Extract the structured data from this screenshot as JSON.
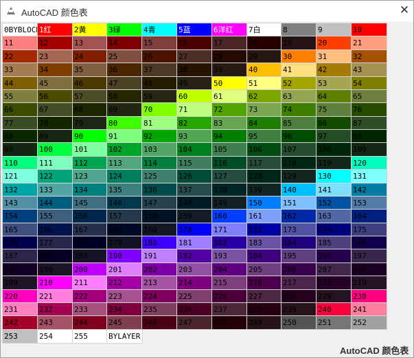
{
  "window": {
    "title": "AutoCAD 颜色表",
    "close_glyph": "✕",
    "footer_label": "AutoCAD 颜色表"
  },
  "special_labels": {
    "0": "0BYBLOCK",
    "1": "1红",
    "2": "2黄",
    "3": "3绿",
    "4": "4青",
    "5": "5蓝",
    "6": "6洋红",
    "7": "7白",
    "256": "BYLAYER"
  },
  "palette": [
    "#ffffff",
    "#ff0000",
    "#ffff00",
    "#00ff00",
    "#00ffff",
    "#0000ff",
    "#ff00ff",
    "#ffffff",
    "#808080",
    "#c0c0c0",
    "#ff0000",
    "#ff7f7f",
    "#a50000",
    "#a55252",
    "#7f0000",
    "#7f3f3f",
    "#4c0000",
    "#4c2626",
    "#260000",
    "#261313",
    "#ff3f00",
    "#ff9f7f",
    "#a52900",
    "#a56752",
    "#7f1f00",
    "#7f4f3f",
    "#4c1300",
    "#4c2f26",
    "#260900",
    "#261713",
    "#ff7f00",
    "#ffbf7f",
    "#a55200",
    "#a57c52",
    "#7f3f00",
    "#7f5f3f",
    "#4c2600",
    "#4c3926",
    "#261300",
    "#261c13",
    "#ffbf00",
    "#ffdf7f",
    "#a57c00",
    "#a59152",
    "#7f5f00",
    "#7f6f3f",
    "#4c3900",
    "#4c4226",
    "#261c00",
    "#262113",
    "#ffff00",
    "#ffff7f",
    "#a5a500",
    "#a5a552",
    "#7f7f00",
    "#7f7f3f",
    "#4c4c00",
    "#4c4c26",
    "#262600",
    "#262613",
    "#bfff00",
    "#dfff7f",
    "#7ca500",
    "#91a552",
    "#5f7f00",
    "#6f7f3f",
    "#394c00",
    "#424c26",
    "#1c2600",
    "#212613",
    "#7fff00",
    "#bfff7f",
    "#52a500",
    "#7ca552",
    "#3f7f00",
    "#5f7f3f",
    "#264c00",
    "#394c26",
    "#132600",
    "#1c2613",
    "#3fff00",
    "#9fff7f",
    "#29a500",
    "#67a552",
    "#1f7f00",
    "#4f7f3f",
    "#134c00",
    "#2f4c26",
    "#092600",
    "#172613",
    "#00ff00",
    "#7fff7f",
    "#00a500",
    "#52a552",
    "#007f00",
    "#3f7f3f",
    "#004c00",
    "#264c26",
    "#002600",
    "#132613",
    "#00ff3f",
    "#7fff9f",
    "#00a529",
    "#52a567",
    "#007f1f",
    "#3f7f4f",
    "#004c13",
    "#264c2f",
    "#002609",
    "#132617",
    "#00ff7f",
    "#7fffbf",
    "#00a552",
    "#52a57c",
    "#007f3f",
    "#3f7f5f",
    "#004c26",
    "#264c39",
    "#002613",
    "#13261c",
    "#00ffbf",
    "#7fffdf",
    "#00a57c",
    "#52a591",
    "#007f5f",
    "#3f7f6f",
    "#004c39",
    "#264c42",
    "#00261c",
    "#132621",
    "#00ffff",
    "#7fffff",
    "#00a5a5",
    "#52a5a5",
    "#007f7f",
    "#3f7f7f",
    "#004c4c",
    "#264c4c",
    "#002626",
    "#132626",
    "#00bfff",
    "#7fdfff",
    "#007ca5",
    "#5291a5",
    "#005f7f",
    "#3f6f7f",
    "#00394c",
    "#26424c",
    "#001c26",
    "#132126",
    "#007fff",
    "#7fbfff",
    "#0052a5",
    "#527ca5",
    "#003f7f",
    "#3f5f7f",
    "#00264c",
    "#26394c",
    "#001326",
    "#131c26",
    "#003fff",
    "#7f9fff",
    "#0029a5",
    "#5267a5",
    "#001f7f",
    "#3f4f7f",
    "#00134c",
    "#262f4c",
    "#000926",
    "#131726",
    "#0000ff",
    "#7f7fff",
    "#0000a5",
    "#5252a5",
    "#00007f",
    "#3f3f7f",
    "#00004c",
    "#26264c",
    "#000026",
    "#131326",
    "#3f00ff",
    "#9f7fff",
    "#2900a5",
    "#6752a5",
    "#1f007f",
    "#4f3f7f",
    "#13004c",
    "#2f264c",
    "#090026",
    "#171326",
    "#7f00ff",
    "#bf7fff",
    "#5200a5",
    "#7c52a5",
    "#3f007f",
    "#5f3f7f",
    "#26004c",
    "#39264c",
    "#130026",
    "#1c1326",
    "#bf00ff",
    "#df7fff",
    "#7c00a5",
    "#9152a5",
    "#5f007f",
    "#6f3f7f",
    "#39004c",
    "#42264c",
    "#1c0026",
    "#211326",
    "#ff00ff",
    "#ff7fff",
    "#a500a5",
    "#a552a5",
    "#7f007f",
    "#7f3f7f",
    "#4c004c",
    "#4c264c",
    "#260026",
    "#261326",
    "#ff00bf",
    "#ff7fdf",
    "#a5007c",
    "#a55291",
    "#7f005f",
    "#7f3f6f",
    "#4c0039",
    "#4c2642",
    "#26001c",
    "#261321",
    "#ff007f",
    "#ff7fbf",
    "#a50052",
    "#a5527c",
    "#7f003f",
    "#7f3f5f",
    "#4c0026",
    "#4c2639",
    "#260013",
    "#26131c",
    "#ff003f",
    "#ff7f9f",
    "#a50029",
    "#a55267",
    "#7f001f",
    "#7f3f4f",
    "#4c0013",
    "#4c262f",
    "#260009",
    "#261317",
    "#545454",
    "#767676",
    "#a0a0a0",
    "#c0c0c0",
    "#ffffff",
    "#ffffff",
    "#ffffff"
  ]
}
